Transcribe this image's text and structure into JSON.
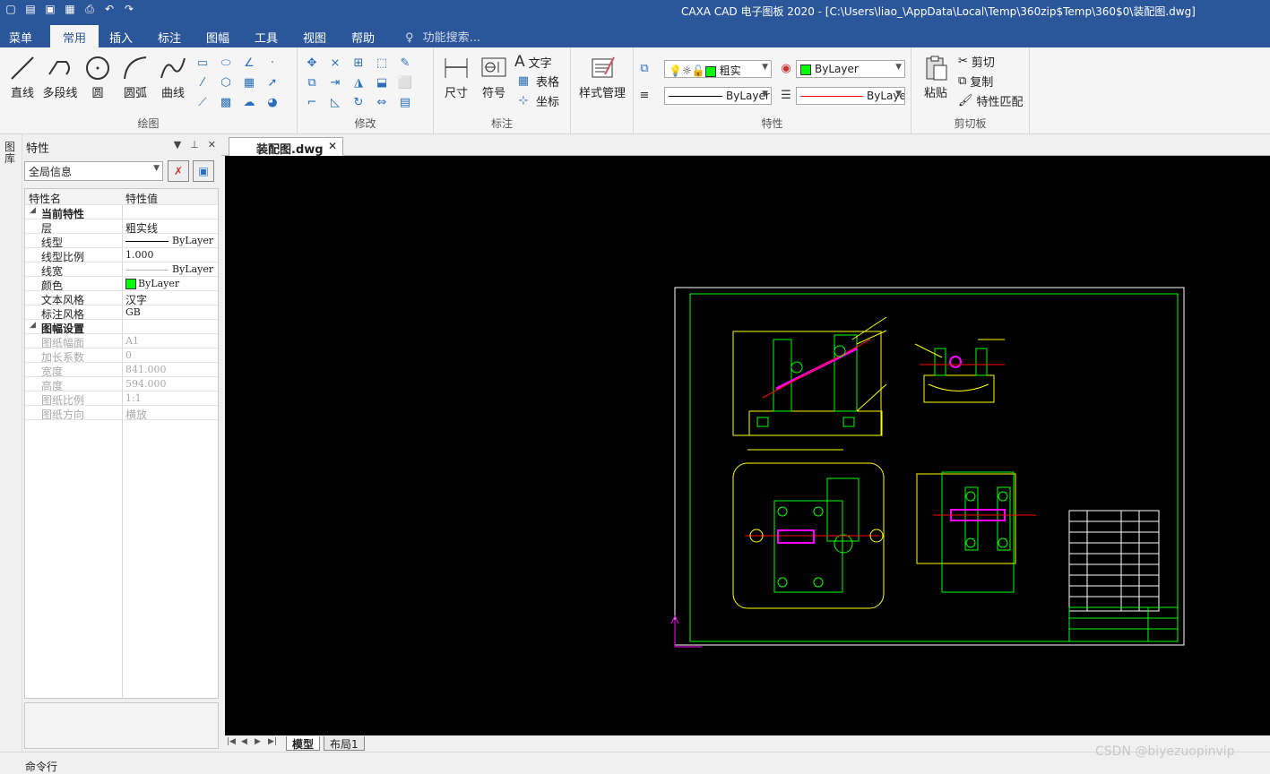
{
  "window": {
    "title": "CAXA CAD 电子图板 2020 - [C:\\Users\\liao_\\AppData\\Local\\Temp\\360zip$Temp\\360$0\\装配图.dwg]",
    "quick_access": [
      "new-icon",
      "open-icon",
      "save-icon",
      "save-as-icon",
      "print-icon",
      "undo-icon",
      "redo-icon"
    ]
  },
  "ribbon_tabs": [
    {
      "label": "菜单"
    },
    {
      "label": "常用"
    },
    {
      "label": "插入"
    },
    {
      "label": "标注"
    },
    {
      "label": "图幅"
    },
    {
      "label": "工具"
    },
    {
      "label": "视图"
    },
    {
      "label": "帮助"
    }
  ],
  "active_tab": "常用",
  "search": {
    "placeholder": "功能搜索..."
  },
  "ribbon": {
    "draw": {
      "label": "绘图",
      "buttons": [
        "直线",
        "多段线",
        "圆",
        "圆弧",
        "曲线"
      ]
    },
    "modify": {
      "label": "修改"
    },
    "annotate": {
      "label": "标注",
      "buttons": [
        "尺寸",
        "符号"
      ],
      "small": [
        "文字",
        "表格",
        "坐标"
      ]
    },
    "style": {
      "label": "样式管理"
    },
    "properties": {
      "label": "特性",
      "layer": "粗实",
      "color": "ByLayer",
      "linetype": "ByLayer",
      "lineweight": "ByLaye"
    },
    "clipboard": {
      "label": "剪切板",
      "paste": "粘贴",
      "items": [
        "剪切",
        "复制",
        "特性匹配"
      ]
    }
  },
  "left_strip": {
    "label": "图库"
  },
  "panel": {
    "title": "特性",
    "scope": "全局信息",
    "columns": [
      "特性名",
      "特性值"
    ],
    "current": {
      "title": "当前特性",
      "rows": [
        {
          "name": "层",
          "value": "粗实线"
        },
        {
          "name": "线型",
          "value": "ByLayer"
        },
        {
          "name": "线型比例",
          "value": "1.000"
        },
        {
          "name": "线宽",
          "value": "ByLayer"
        },
        {
          "name": "颜色",
          "value": "ByLayer"
        },
        {
          "name": "文本风格",
          "value": "汉字"
        },
        {
          "name": "标注风格",
          "value": "GB"
        }
      ]
    },
    "sheet": {
      "title": "图幅设置",
      "rows": [
        {
          "name": "图纸幅面",
          "value": "A1"
        },
        {
          "name": "加长系数",
          "value": "0"
        },
        {
          "name": "宽度",
          "value": "841.000"
        },
        {
          "name": "高度",
          "value": "594.000"
        },
        {
          "name": "图纸比例",
          "value": "1:1"
        },
        {
          "name": "图纸方向",
          "value": "横放"
        }
      ]
    }
  },
  "doc_tab": {
    "label": "装配图.dwg"
  },
  "layout_tabs": [
    {
      "label": "模型"
    },
    {
      "label": "布局1"
    }
  ],
  "command": {
    "label": "命令行"
  },
  "watermark": "CSDN @biyezuopinvip",
  "colors": {
    "titlebar": "#2b579a",
    "canvas": "#000000",
    "frame": "#ffffff",
    "border": "#00ff00",
    "part": "#ffff00",
    "center": "#ff0000",
    "accent": "#ff00ff"
  }
}
